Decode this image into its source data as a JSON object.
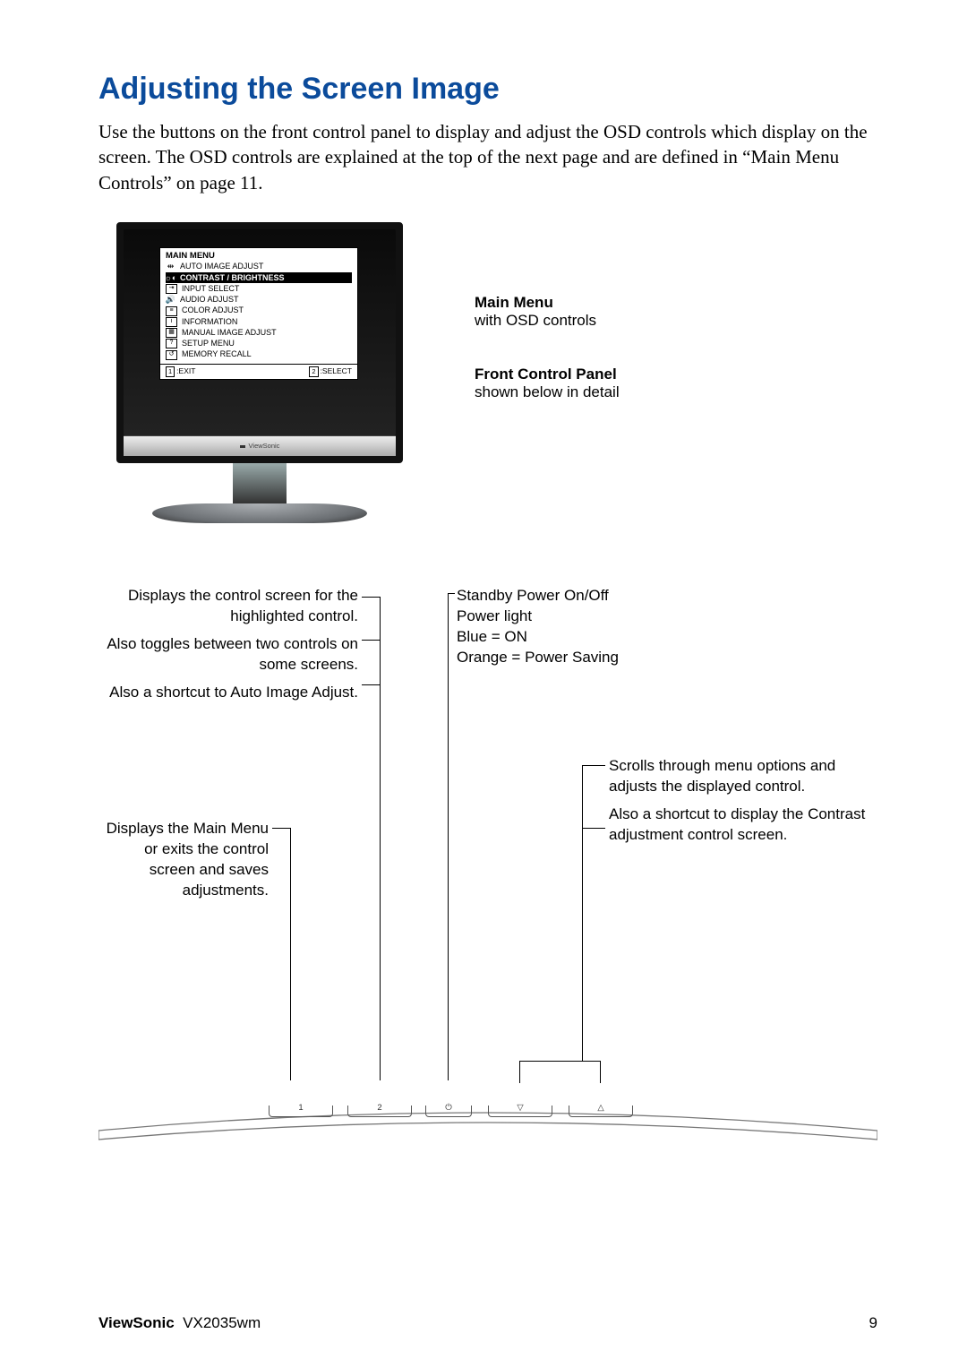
{
  "title": "Adjusting the Screen Image",
  "intro": "Use the buttons on the front control panel to display and adjust the OSD controls which display on the screen. The OSD controls are explained at the top of the next page and are defined in “Main Menu Controls” on page 11.",
  "osd": {
    "title": "MAIN MENU",
    "items": [
      "AUTO IMAGE ADJUST",
      "CONTRAST / BRIGHTNESS",
      "INPUT SELECT",
      "AUDIO ADJUST",
      "COLOR ADJUST",
      "INFORMATION",
      "MANUAL IMAGE ADJUST",
      "SETUP MENU",
      "MEMORY RECALL"
    ],
    "footer_exit": ":EXIT",
    "footer_exit_key": "1",
    "footer_select": ":SELECT",
    "footer_select_key": "2"
  },
  "monitor_brand": "ViewSonic",
  "cap_main_title": "Main Menu",
  "cap_main_sub": "with OSD controls",
  "cap_front_title": "Front Control Panel",
  "cap_front_sub": "shown below in detail",
  "panel": {
    "left1a": "Displays the control screen for the highlighted control.",
    "left1b": "Also toggles between two controls on some screens.",
    "left1c": "Also a shortcut to Auto Image Adjust.",
    "left2": "Displays the Main Menu or exits the control screen and saves adjustments.",
    "right1a": "Standby Power On/Off",
    "right1b": "Power light",
    "right1c": "Blue = ON",
    "right1d": "Orange = Power Saving",
    "right2a": "Scrolls through menu options and adjusts the displayed control.",
    "right2b": "Also a shortcut to display the Contrast adjustment control screen."
  },
  "buttons": {
    "b1": "1",
    "b2": "2",
    "pwr": "⏻",
    "down": "▽",
    "up": "△"
  },
  "footer": {
    "brand_bold": "ViewSonic",
    "brand_rest": "VX2035wm",
    "page": "9"
  }
}
